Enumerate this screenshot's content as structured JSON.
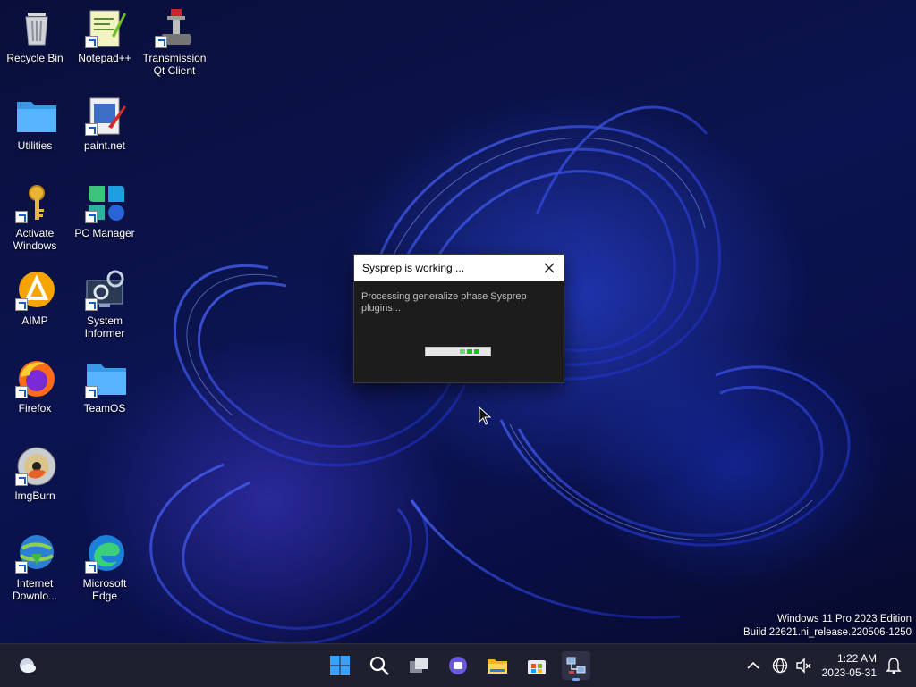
{
  "desktop_icons": [
    {
      "id": "recycle-bin",
      "label": "Recycle Bin",
      "icon": "recycle-bin-icon",
      "shortcut": false
    },
    {
      "id": "utilities",
      "label": "Utilities",
      "icon": "folder-icon",
      "shortcut": false
    },
    {
      "id": "activate-windows",
      "label": "Activate Windows",
      "icon": "key-icon",
      "shortcut": true
    },
    {
      "id": "aimp",
      "label": "AIMP",
      "icon": "aimp-icon",
      "shortcut": true
    },
    {
      "id": "firefox",
      "label": "Firefox",
      "icon": "firefox-icon",
      "shortcut": true
    },
    {
      "id": "imgburn",
      "label": "ImgBurn",
      "icon": "disc-icon",
      "shortcut": true
    },
    {
      "id": "internet-download",
      "label": "Internet Downlo...",
      "icon": "globe-download-icon",
      "shortcut": true
    },
    {
      "id": "notepadpp",
      "label": "Notepad++",
      "icon": "notepad-icon",
      "shortcut": true
    },
    {
      "id": "paintnet",
      "label": "paint.net",
      "icon": "paint-icon",
      "shortcut": true
    },
    {
      "id": "pc-manager",
      "label": "PC Manager",
      "icon": "pc-manager-icon",
      "shortcut": true
    },
    {
      "id": "system-informer",
      "label": "System Informer",
      "icon": "gear-monitor-icon",
      "shortcut": true
    },
    {
      "id": "teamos",
      "label": "TeamOS",
      "icon": "folder-icon",
      "shortcut": false
    },
    {
      "id": "microsoft-edge",
      "label": "Microsoft Edge",
      "icon": "edge-icon",
      "shortcut": true
    },
    {
      "id": "transmission",
      "label": "Transmission Qt Client",
      "icon": "transmission-icon",
      "shortcut": true
    }
  ],
  "dialog": {
    "title": "Sysprep is working ...",
    "message": "Processing generalize phase Sysprep plugins...",
    "progress_segments_active": 3
  },
  "watermark": {
    "line1": "Windows 11 Pro 2023 Edition",
    "line2": "Build 22621.ni_release.220506-1250"
  },
  "taskbar": {
    "apps": [
      "start-icon",
      "search-icon",
      "task-view-icon",
      "teams-chat-icon",
      "file-explorer-icon",
      "store-icon",
      "sysprep-icon"
    ],
    "clock": {
      "time": "1:22 AM",
      "date": "2023-05-31"
    }
  },
  "colors": {
    "taskbar": "#1e2030",
    "dialog_body": "#1c1c1c",
    "progress_green": "#19c219",
    "accent": "#0078d4"
  }
}
